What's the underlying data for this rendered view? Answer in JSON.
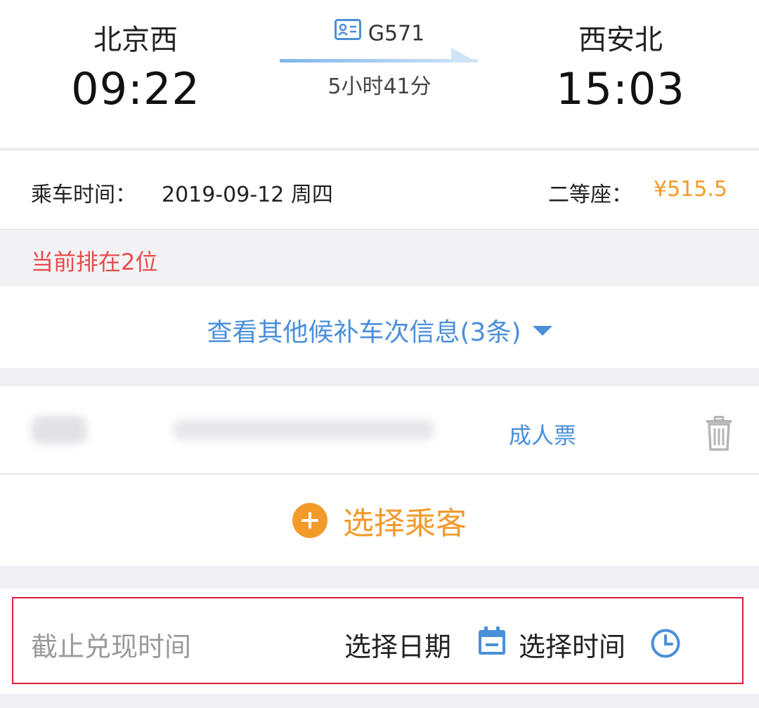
{
  "train": {
    "departure_station": "北京西",
    "departure_time": "09:22",
    "train_number": "G571",
    "duration": "5小时41分",
    "arrival_station": "西安北",
    "arrival_time": "15:03",
    "id_icon": "id-card-icon"
  },
  "ride_info": {
    "date_label": "乘车时间：",
    "date_value": "2019-09-12 周四",
    "seat_label": "二等座：",
    "price": "¥515.5",
    "price_color": "#f39a2b"
  },
  "queue": {
    "text": "当前排在2位",
    "color": "#e84b4b"
  },
  "other_trains": {
    "link_text": "查看其他候补车次信息(3条)",
    "icon": "caret-down-icon",
    "color": "#4a8fd8"
  },
  "passenger": {
    "ticket_type": "成人票",
    "delete_icon": "trash-icon"
  },
  "add_passenger": {
    "label": "选择乘客",
    "icon": "plus-circle-icon",
    "color": "#f39a2b"
  },
  "deadline": {
    "label": "截止兑现时间",
    "pick_date": "选择日期",
    "date_icon": "calendar-icon",
    "pick_time": "选择时间",
    "time_icon": "clock-icon",
    "highlight_color": "#d9213a"
  }
}
